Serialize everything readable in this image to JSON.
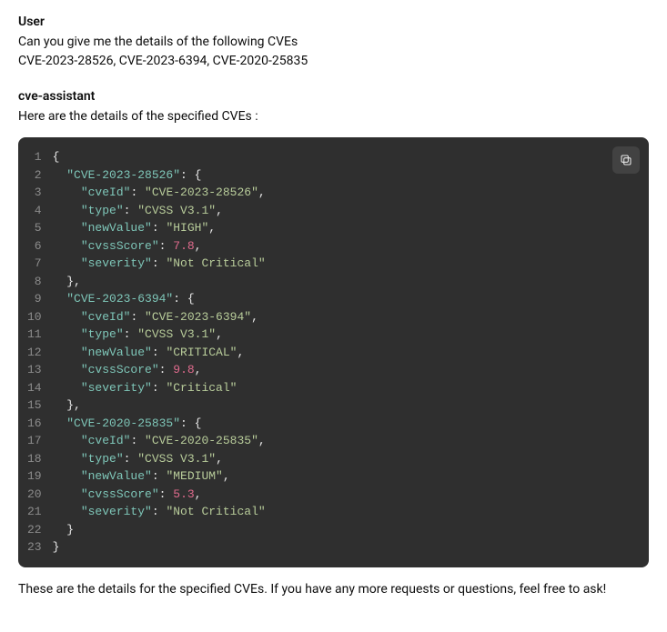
{
  "user": {
    "role": "User",
    "line1": "Can you give me the details of the following CVEs",
    "line2": "CVE-2023-28526, CVE-2023-6394, CVE-2020-25835"
  },
  "assistant": {
    "role": "cve-assistant",
    "intro": "Here are the details of the specified CVEs :",
    "outro": "These are the details for the specified CVEs. If you have any more requests or questions, feel free to ask!"
  },
  "code": {
    "lines": [
      {
        "n": "1",
        "tokens": [
          [
            "punc",
            "{"
          ]
        ]
      },
      {
        "n": "2",
        "tokens": [
          [
            "indent",
            "  "
          ],
          [
            "key",
            "\"CVE-2023-28526\""
          ],
          [
            "punc",
            ": {"
          ]
        ]
      },
      {
        "n": "3",
        "tokens": [
          [
            "indent",
            "    "
          ],
          [
            "key",
            "\"cveId\""
          ],
          [
            "punc",
            ": "
          ],
          [
            "str",
            "\"CVE-2023-28526\""
          ],
          [
            "punc",
            ","
          ]
        ]
      },
      {
        "n": "4",
        "tokens": [
          [
            "indent",
            "    "
          ],
          [
            "key",
            "\"type\""
          ],
          [
            "punc",
            ": "
          ],
          [
            "str",
            "\"CVSS V3.1\""
          ],
          [
            "punc",
            ","
          ]
        ]
      },
      {
        "n": "5",
        "tokens": [
          [
            "indent",
            "    "
          ],
          [
            "key",
            "\"newValue\""
          ],
          [
            "punc",
            ": "
          ],
          [
            "str",
            "\"HIGH\""
          ],
          [
            "punc",
            ","
          ]
        ]
      },
      {
        "n": "6",
        "tokens": [
          [
            "indent",
            "    "
          ],
          [
            "key",
            "\"cvssScore\""
          ],
          [
            "punc",
            ": "
          ],
          [
            "num",
            "7.8"
          ],
          [
            "punc",
            ","
          ]
        ]
      },
      {
        "n": "7",
        "tokens": [
          [
            "indent",
            "    "
          ],
          [
            "key",
            "\"severity\""
          ],
          [
            "punc",
            ": "
          ],
          [
            "str",
            "\"Not Critical\""
          ]
        ]
      },
      {
        "n": "8",
        "tokens": [
          [
            "indent",
            "  "
          ],
          [
            "punc",
            "},"
          ]
        ]
      },
      {
        "n": "9",
        "tokens": [
          [
            "indent",
            "  "
          ],
          [
            "key",
            "\"CVE-2023-6394\""
          ],
          [
            "punc",
            ": {"
          ]
        ]
      },
      {
        "n": "10",
        "tokens": [
          [
            "indent",
            "    "
          ],
          [
            "key",
            "\"cveId\""
          ],
          [
            "punc",
            ": "
          ],
          [
            "str",
            "\"CVE-2023-6394\""
          ],
          [
            "punc",
            ","
          ]
        ]
      },
      {
        "n": "11",
        "tokens": [
          [
            "indent",
            "    "
          ],
          [
            "key",
            "\"type\""
          ],
          [
            "punc",
            ": "
          ],
          [
            "str",
            "\"CVSS V3.1\""
          ],
          [
            "punc",
            ","
          ]
        ]
      },
      {
        "n": "12",
        "tokens": [
          [
            "indent",
            "    "
          ],
          [
            "key",
            "\"newValue\""
          ],
          [
            "punc",
            ": "
          ],
          [
            "str",
            "\"CRITICAL\""
          ],
          [
            "punc",
            ","
          ]
        ]
      },
      {
        "n": "13",
        "tokens": [
          [
            "indent",
            "    "
          ],
          [
            "key",
            "\"cvssScore\""
          ],
          [
            "punc",
            ": "
          ],
          [
            "num",
            "9.8"
          ],
          [
            "punc",
            ","
          ]
        ]
      },
      {
        "n": "14",
        "tokens": [
          [
            "indent",
            "    "
          ],
          [
            "key",
            "\"severity\""
          ],
          [
            "punc",
            ": "
          ],
          [
            "str",
            "\"Critical\""
          ]
        ]
      },
      {
        "n": "15",
        "tokens": [
          [
            "indent",
            "  "
          ],
          [
            "punc",
            "},"
          ]
        ]
      },
      {
        "n": "16",
        "tokens": [
          [
            "indent",
            "  "
          ],
          [
            "key",
            "\"CVE-2020-25835\""
          ],
          [
            "punc",
            ": {"
          ]
        ]
      },
      {
        "n": "17",
        "tokens": [
          [
            "indent",
            "    "
          ],
          [
            "key",
            "\"cveId\""
          ],
          [
            "punc",
            ": "
          ],
          [
            "str",
            "\"CVE-2020-25835\""
          ],
          [
            "punc",
            ","
          ]
        ]
      },
      {
        "n": "18",
        "tokens": [
          [
            "indent",
            "    "
          ],
          [
            "key",
            "\"type\""
          ],
          [
            "punc",
            ": "
          ],
          [
            "str",
            "\"CVSS V3.1\""
          ],
          [
            "punc",
            ","
          ]
        ]
      },
      {
        "n": "19",
        "tokens": [
          [
            "indent",
            "    "
          ],
          [
            "key",
            "\"newValue\""
          ],
          [
            "punc",
            ": "
          ],
          [
            "str",
            "\"MEDIUM\""
          ],
          [
            "punc",
            ","
          ]
        ]
      },
      {
        "n": "20",
        "tokens": [
          [
            "indent",
            "    "
          ],
          [
            "key",
            "\"cvssScore\""
          ],
          [
            "punc",
            ": "
          ],
          [
            "num",
            "5.3"
          ],
          [
            "punc",
            ","
          ]
        ]
      },
      {
        "n": "21",
        "tokens": [
          [
            "indent",
            "    "
          ],
          [
            "key",
            "\"severity\""
          ],
          [
            "punc",
            ": "
          ],
          [
            "str",
            "\"Not Critical\""
          ]
        ]
      },
      {
        "n": "22",
        "tokens": [
          [
            "indent",
            "  "
          ],
          [
            "punc",
            "}"
          ]
        ]
      },
      {
        "n": "23",
        "tokens": [
          [
            "punc",
            "}"
          ]
        ]
      }
    ]
  }
}
